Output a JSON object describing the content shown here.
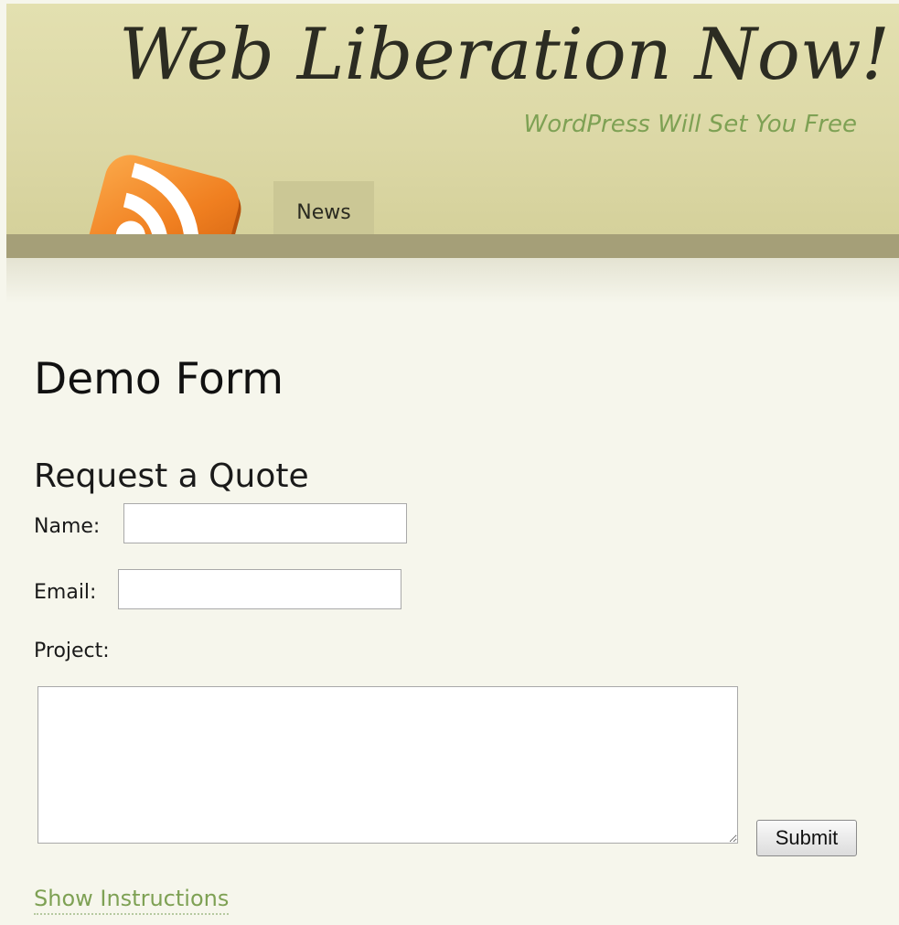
{
  "header": {
    "site_title": "Web Liberation Now!",
    "tagline": "WordPress Will Set You Free",
    "rss_icon": "rss-feed-icon"
  },
  "nav": {
    "items": [
      {
        "label": "News"
      }
    ]
  },
  "main": {
    "page_title": "Demo Form",
    "form": {
      "title": "Request a Quote",
      "name_label": "Name:",
      "name_value": "",
      "email_label": "Email:",
      "email_value": "",
      "project_label": "Project:",
      "project_value": "",
      "submit_label": "Submit"
    },
    "show_instructions": "Show Instructions"
  },
  "colors": {
    "header_bg": "#dcd8a6",
    "nav_bar": "#a59f78",
    "tagline": "#7ea154",
    "page_bg": "#f6f6ec",
    "rss_orange": "#ee7d1d"
  }
}
